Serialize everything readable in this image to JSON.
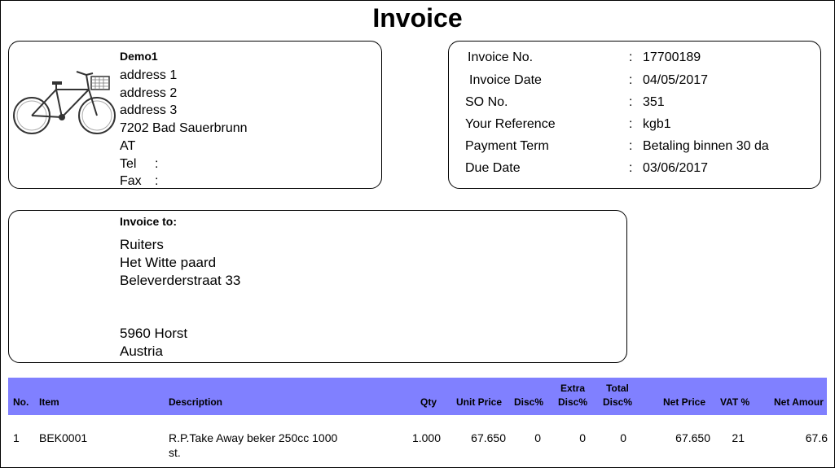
{
  "title": "Invoice",
  "company": {
    "name": "Demo1",
    "address1": "address 1",
    "address2": "address 2",
    "address3": "address 3",
    "city": "7202 Bad Sauerbrunn",
    "country": "AT",
    "tel_label": "Tel",
    "tel_value": ":",
    "fax_label": "Fax",
    "fax_value": ":"
  },
  "info": [
    {
      "label": "Invoice No.",
      "value": "17700189"
    },
    {
      "label": "Invoice Date",
      "value": "04/05/2017"
    },
    {
      "label": "SO No.",
      "value": "351"
    },
    {
      "label": "Your Reference",
      "value": "kgb1"
    },
    {
      "label": "Payment Term",
      "value": "Betaling binnen 30 da"
    },
    {
      "label": "Due Date",
      "value": "03/06/2017"
    }
  ],
  "info_sep": ":",
  "invoice_to": {
    "heading": "Invoice to:",
    "line1": "Ruiters",
    "line2": "Het Witte paard",
    "line3": "Beleverderstraat 33",
    "line4": "5960 Horst",
    "line5": "Austria"
  },
  "table": {
    "headers": {
      "no": "No.",
      "item": "Item",
      "description": "Description",
      "qty": "Qty",
      "unit_price": "Unit Price",
      "disc": "Disc%",
      "extra_disc_1": "Extra",
      "extra_disc_2": "Disc%",
      "total_disc_1": "Total",
      "total_disc_2": "Disc%",
      "net_price": "Net Price",
      "vat": "VAT %",
      "net_amount": "Net Amour"
    },
    "rows": [
      {
        "no": "1",
        "item": "BEK0001",
        "description_1": "R.P.Take Away beker 250cc 1000",
        "description_2": "st.",
        "qty": "1.000",
        "unit_price": "67.650",
        "disc": "0",
        "extra_disc": "0",
        "total_disc": "0",
        "net_price": "67.650",
        "vat": "21",
        "net_amount": "67.6"
      }
    ]
  },
  "colors": {
    "table_header": "#8080ff"
  }
}
